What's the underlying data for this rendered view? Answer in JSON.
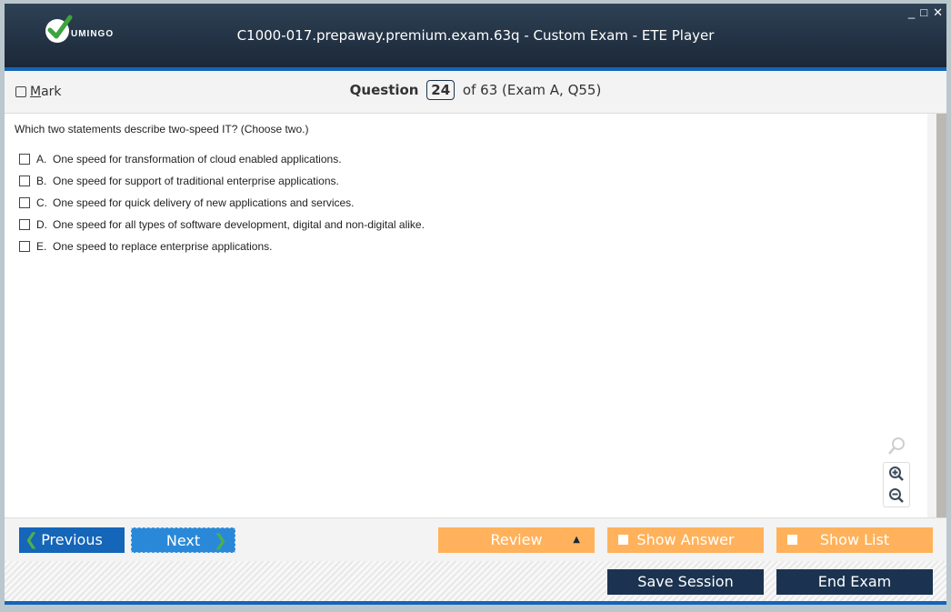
{
  "window": {
    "brand": "UMINGO",
    "title": "C1000-017.prepaway.premium.exam.63q - Custom Exam - ETE Player",
    "controls": {
      "minimize": "_",
      "maximize": "□",
      "close": "✕"
    }
  },
  "question_bar": {
    "mark_label": "Mark",
    "mark_underline_char": "M",
    "mark_rest": "ark",
    "question_label": "Question",
    "question_number": "24",
    "of_text": "of 63 (Exam A, Q55)"
  },
  "question": {
    "text": "Which two statements describe two-speed IT? (Choose two.)",
    "options": [
      {
        "letter": "A.",
        "text": "One speed for transformation of cloud enabled applications.",
        "checked": false
      },
      {
        "letter": "B.",
        "text": "One speed for support of traditional enterprise applications.",
        "checked": false
      },
      {
        "letter": "C.",
        "text": "One speed for quick delivery of new applications and services.",
        "checked": false
      },
      {
        "letter": "D.",
        "text": "One speed for all types of software development, digital and non-digital alike.",
        "checked": false
      },
      {
        "letter": "E.",
        "text": "One speed to replace enterprise applications.",
        "checked": false
      }
    ]
  },
  "zoom_tools": {
    "icons": [
      "search-icon",
      "zoom-in-icon",
      "zoom-out-icon"
    ]
  },
  "nav": {
    "previous": "Previous",
    "next": "Next",
    "review": "Review",
    "show_answer": "Show Answer",
    "show_list": "Show List"
  },
  "footer": {
    "save_session": "Save Session",
    "end_exam": "End Exam"
  },
  "colors": {
    "accent_blue": "#1565b8",
    "orange": "#ffb25b",
    "dark_navy": "#1b3350",
    "check_green": "#4caf50"
  }
}
